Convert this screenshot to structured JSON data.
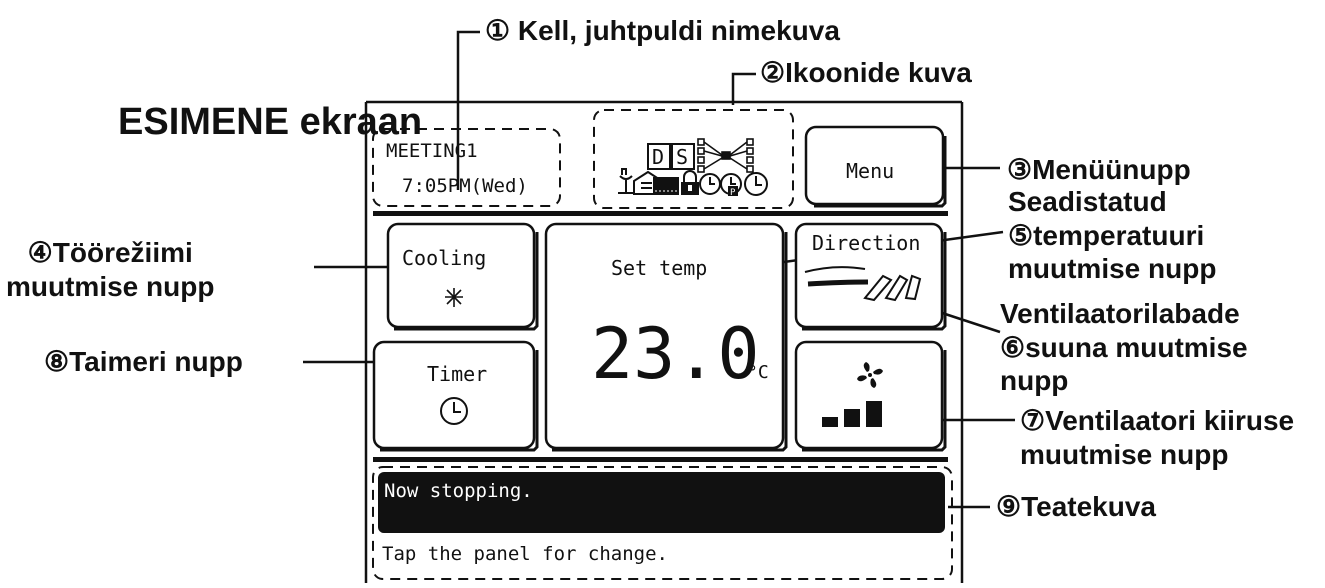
{
  "screen_title": "ESIMENE ekraan",
  "callouts": {
    "c1": "① Kell, juhtpuldi nimekuva",
    "c2": "②Ikoonide kuva",
    "c3": "③Menüünupp",
    "c4": "④Töörežiimi\nmuutmise nupp",
    "c5": "Seadistatud\n⑤temperatuuri\nmuutmise nupp",
    "c6": "Ventilaatorilabade\n⑥suuna muutmise\nnupp",
    "c7": "⑦Ventilaatori kiiruse\nmuutmise nupp",
    "c8": "⑧Taimeri nupp",
    "c9": "⑨Teatekuva"
  },
  "panel": {
    "name": "MEETING1",
    "clock": "7:05PM(Wed)",
    "icons": [
      "D-icon",
      "S-icon",
      "network-icon",
      "maintenance-icon",
      "home-icon",
      "filter-icon",
      "lock-icon",
      "timer-on-icon",
      "timer-program-icon",
      "clock-icon"
    ],
    "menu_label": "Menu",
    "mode_label": "Cooling",
    "mode_icon": "snowflake-icon",
    "set_temp_label": "Set temp",
    "temperature": "23.0",
    "temp_unit": "°C",
    "direction_label": "Direction",
    "fan_icon": "fan-icon",
    "fan_speed_level": 3,
    "fan_speed_max": 4,
    "timer_label": "Timer",
    "message": "Now stopping.",
    "hint": "Tap the panel for change."
  }
}
